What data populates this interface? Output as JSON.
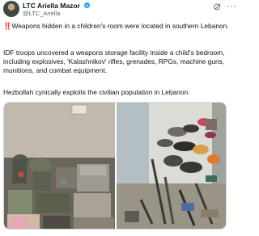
{
  "tweet": {
    "author_name": "LTC Ariella Mazor",
    "handle": "@LTC_Ariella",
    "paragraphs": {
      "p1_icon": "‼️",
      "p1": "Weapons hidden in a children's room were located in southern Lebanon.",
      "p2": "IDF troops uncovered a weapons storage facility inside a child's bedroom, including  explosives, 'Kalashnikov' rifles, grenades, RPGs, machine guns, munitions, and combat equipment.",
      "p3": "Hezbollah cynically exploits the civilian population in Lebanon."
    }
  },
  "icons": {
    "avatar": "profile-photo",
    "verified": "verified-badge-icon",
    "grok": "grok-icon",
    "more": "more-options-icon"
  },
  "colors": {
    "text": "#0f1419",
    "secondary": "#536471",
    "verified": "#1d9bf0",
    "alarm": "#e0245e"
  }
}
